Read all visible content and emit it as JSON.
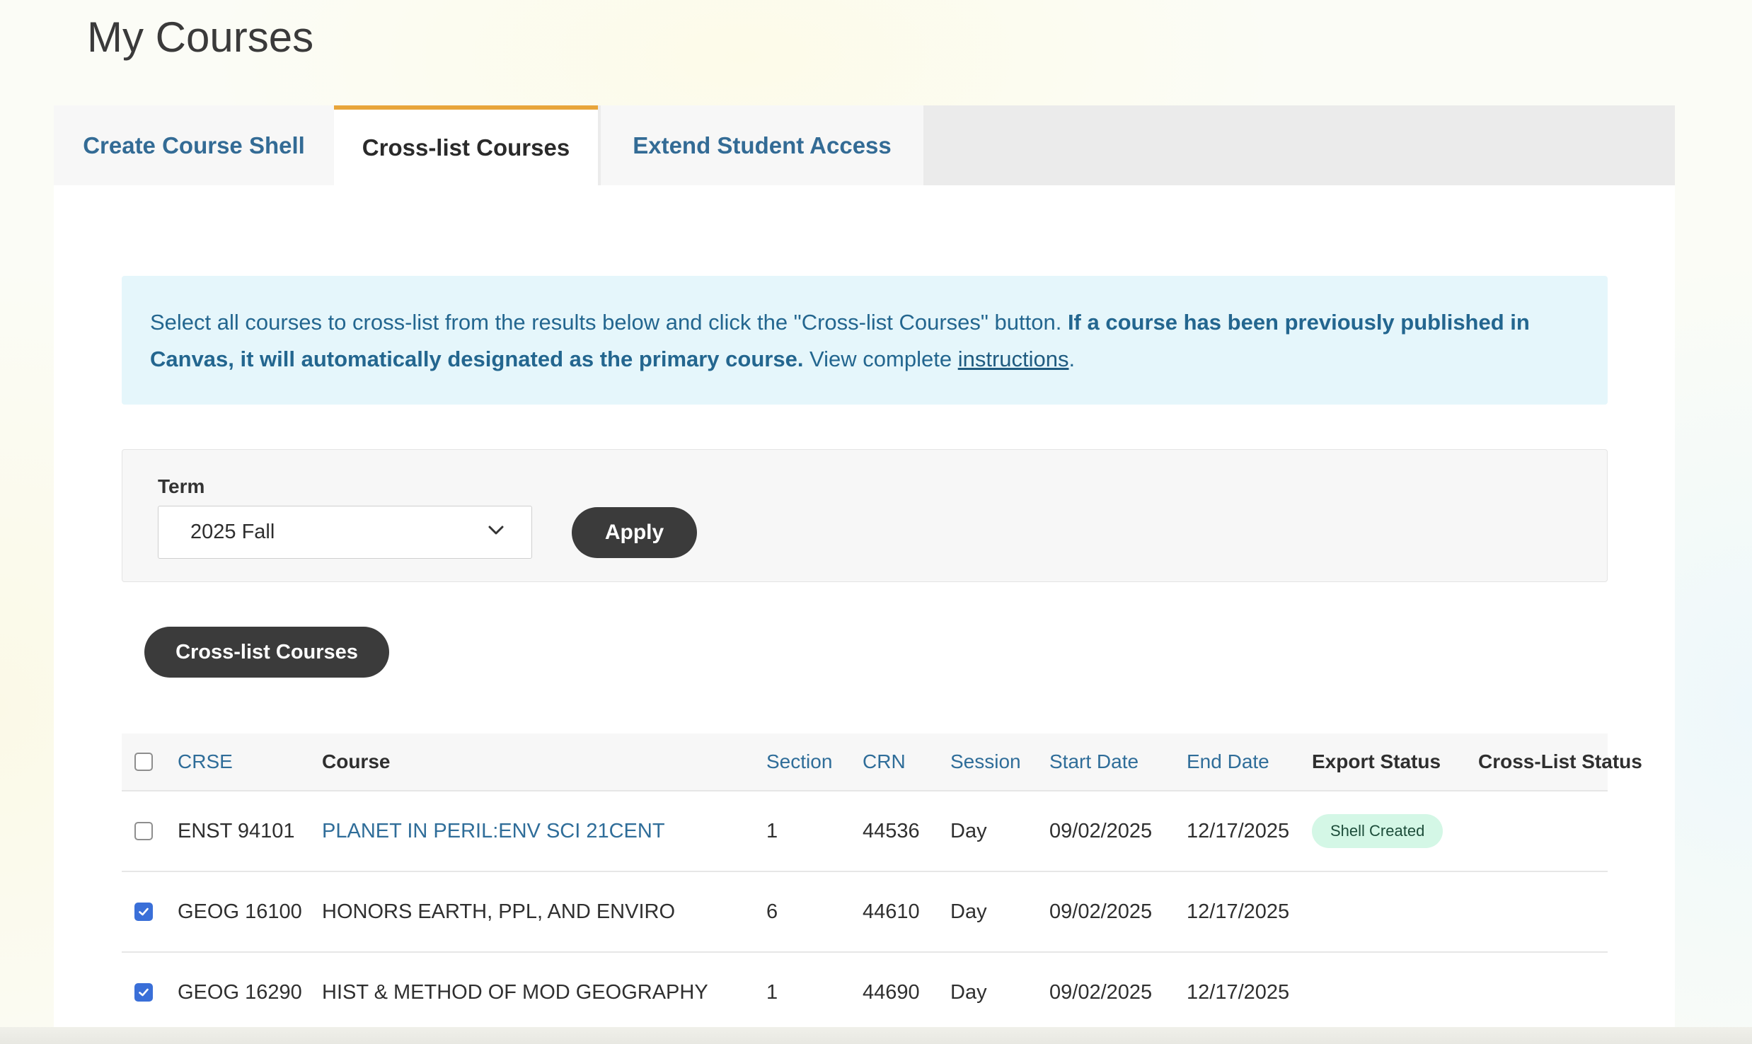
{
  "page": {
    "title": "My Courses"
  },
  "tabs": [
    {
      "label": "Create Course Shell",
      "active": false
    },
    {
      "label": "Cross-list Courses",
      "active": true
    },
    {
      "label": "Extend Student Access",
      "active": false
    }
  ],
  "alert": {
    "text_1": "Select all courses to cross-list from the results below and click the \"Cross-list Courses\" button. ",
    "text_bold": "If a course has been previously published in Canvas, it will automatically designated as the primary course.",
    "text_2": " View complete ",
    "link": "instructions",
    "text_3": "."
  },
  "filter": {
    "term_label": "Term",
    "term_value": "2025 Fall",
    "apply_label": "Apply"
  },
  "actions": {
    "crosslist_label": "Cross-list Courses"
  },
  "table": {
    "headers": {
      "crse": "CRSE",
      "course": "Course",
      "section": "Section",
      "crn": "CRN",
      "session": "Session",
      "start": "Start Date",
      "end": "End Date",
      "export": "Export Status",
      "xstat": "Cross-List Status"
    },
    "rows": [
      {
        "checked": false,
        "crse": "ENST 94101",
        "course": "PLANET IN PERIL:ENV SCI 21CENT",
        "course_link": true,
        "section": "1",
        "crn": "44536",
        "session": "Day",
        "start": "09/02/2025",
        "end": "12/17/2025",
        "export": "Shell Created",
        "xstat": ""
      },
      {
        "checked": true,
        "crse": "GEOG 16100",
        "course": "HONORS EARTH, PPL, AND ENVIRO",
        "course_link": false,
        "section": "6",
        "crn": "44610",
        "session": "Day",
        "start": "09/02/2025",
        "end": "12/17/2025",
        "export": "",
        "xstat": ""
      },
      {
        "checked": true,
        "crse": "GEOG 16290",
        "course": "HIST & METHOD OF MOD GEOGRAPHY",
        "course_link": false,
        "section": "1",
        "crn": "44690",
        "session": "Day",
        "start": "09/02/2025",
        "end": "12/17/2025",
        "export": "",
        "xstat": ""
      }
    ]
  },
  "colors": {
    "tab_active_accent": "#e8a53b",
    "link": "#2f6d99",
    "alert_bg": "#e5f6fb",
    "badge_bg": "#d4f7e6",
    "checkbox_checked": "#3a6fd8"
  }
}
